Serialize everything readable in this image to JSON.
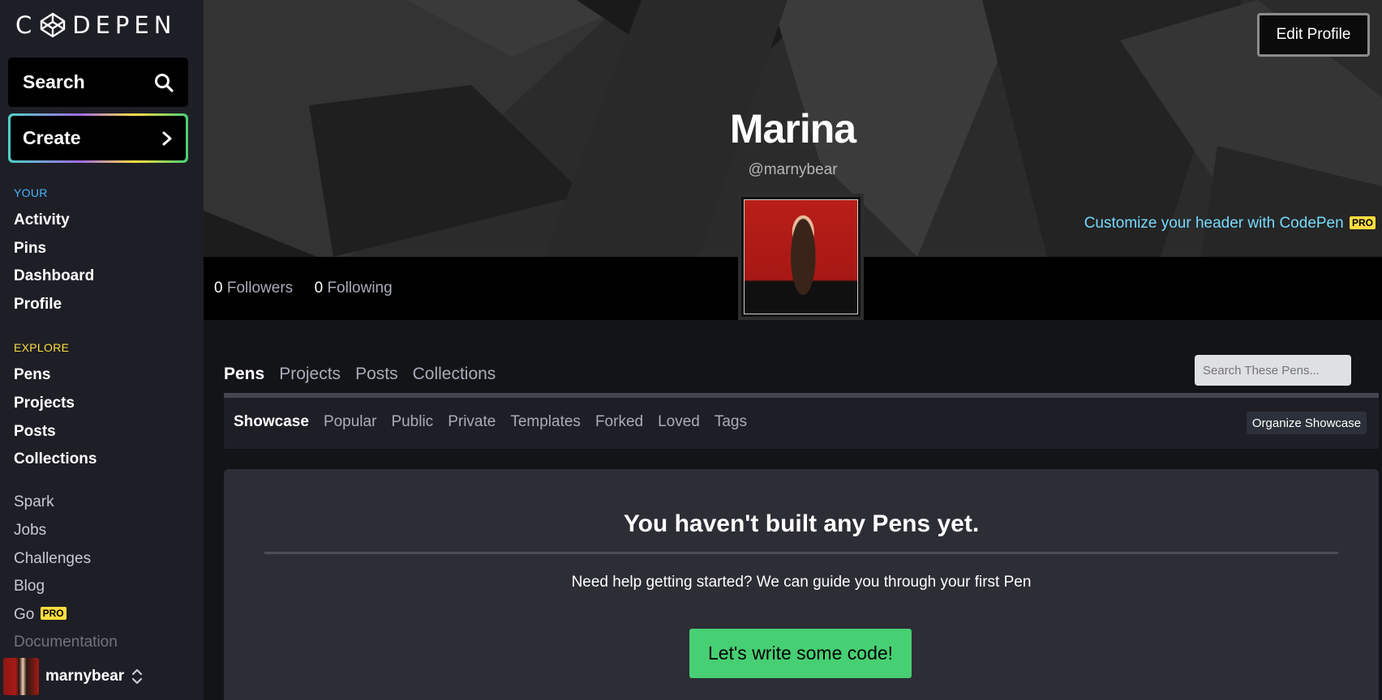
{
  "brand": {
    "logo_text_left": "C",
    "logo_text_right": "DEPEN"
  },
  "sidebar": {
    "search_label": "Search",
    "create_label": "Create",
    "your_label": "YOUR",
    "your_items": [
      "Activity",
      "Pins",
      "Dashboard",
      "Profile"
    ],
    "explore_label": "EXPLORE",
    "explore_items": [
      "Pens",
      "Projects",
      "Posts",
      "Collections"
    ],
    "other_items": [
      "Spark",
      "Jobs",
      "Challenges",
      "Blog",
      "Go",
      "Documentation"
    ],
    "pro_badge": "PRO",
    "user": {
      "name": "marnybear"
    }
  },
  "header": {
    "edit_profile": "Edit Profile",
    "name": "Marina",
    "handle": "@marnybear",
    "customize_text": "Customize your header with CodePen",
    "pro_badge": "PRO"
  },
  "stats": {
    "followers_count": "0",
    "followers_label": "Followers",
    "following_count": "0",
    "following_label": "Following"
  },
  "tabs": [
    "Pens",
    "Projects",
    "Posts",
    "Collections"
  ],
  "search_pens_placeholder": "Search These Pens...",
  "subtabs": [
    "Showcase",
    "Popular",
    "Public",
    "Private",
    "Templates",
    "Forked",
    "Loved",
    "Tags"
  ],
  "organize_label": "Organize Showcase",
  "empty": {
    "title": "You haven't built any Pens yet.",
    "subtitle": "Need help getting started? We can guide you through your first Pen",
    "cta": "Let's write some code!"
  },
  "colors": {
    "accent_green": "#47cf73",
    "pro_yellow": "#ffdd40",
    "link_blue": "#76daff",
    "your_blue": "#47b4ff",
    "explore_yellow": "#ffdd40"
  }
}
